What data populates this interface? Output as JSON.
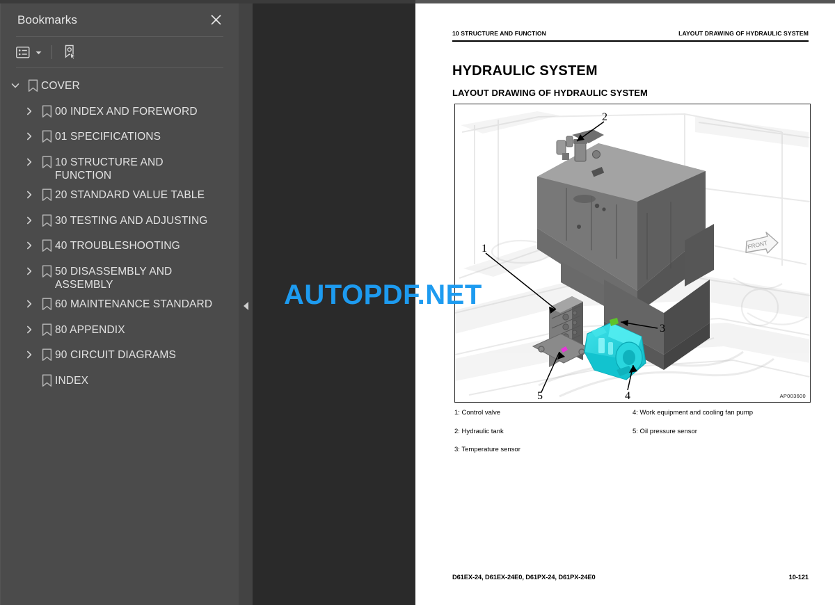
{
  "sidebar": {
    "title": "Bookmarks",
    "close_icon": "close-icon",
    "toolbar": {
      "list_options_icon": "list-options-icon",
      "caret_icon": "chevron-down-icon",
      "new_bookmark_icon": "new-bookmark-icon"
    },
    "items": [
      {
        "label": "COVER",
        "level": 0,
        "expanded": true,
        "has_children": true
      },
      {
        "label": "00 INDEX AND FOREWORD",
        "level": 1,
        "expanded": false,
        "has_children": true
      },
      {
        "label": "01 SPECIFICATIONS",
        "level": 1,
        "expanded": false,
        "has_children": true
      },
      {
        "label": "10 STRUCTURE AND FUNCTION",
        "level": 1,
        "expanded": false,
        "has_children": true
      },
      {
        "label": "20 STANDARD VALUE TABLE",
        "level": 1,
        "expanded": false,
        "has_children": true
      },
      {
        "label": "30 TESTING AND ADJUSTING",
        "level": 1,
        "expanded": false,
        "has_children": true
      },
      {
        "label": "40 TROUBLESHOOTING",
        "level": 1,
        "expanded": false,
        "has_children": true
      },
      {
        "label": "50 DISASSEMBLY AND ASSEMBLY",
        "level": 1,
        "expanded": false,
        "has_children": true
      },
      {
        "label": "60 MAINTENANCE STANDARD",
        "level": 1,
        "expanded": false,
        "has_children": true
      },
      {
        "label": "80 APPENDIX",
        "level": 1,
        "expanded": false,
        "has_children": true
      },
      {
        "label": "90 CIRCUIT DIAGRAMS",
        "level": 1,
        "expanded": false,
        "has_children": true
      },
      {
        "label": "INDEX",
        "level": 1,
        "expanded": false,
        "has_children": false
      }
    ]
  },
  "splitter": {
    "collapse_icon": "collapse-left-icon"
  },
  "watermark": {
    "text": "AUTOPDF.NET",
    "color": "#1d9bf0"
  },
  "page": {
    "header_left": "10 STRUCTURE AND FUNCTION",
    "header_right": "LAYOUT DRAWING OF HYDRAULIC SYSTEM",
    "title": "HYDRAULIC SYSTEM",
    "subtitle": "LAYOUT DRAWING OF HYDRAULIC SYSTEM",
    "figure": {
      "code": "AP003600",
      "orientation_marker": "FRONT",
      "callouts": [
        "1",
        "2",
        "3",
        "4",
        "5"
      ]
    },
    "legend_left": [
      "1: Control valve",
      "2: Hydraulic tank",
      "3: Temperature sensor"
    ],
    "legend_right": [
      "4: Work equipment and cooling fan pump",
      "5: Oil pressure sensor"
    ],
    "footer_left": "D61EX-24, D61EX-24E0, D61PX-24, D61PX-24E0",
    "footer_right": "10-121"
  }
}
